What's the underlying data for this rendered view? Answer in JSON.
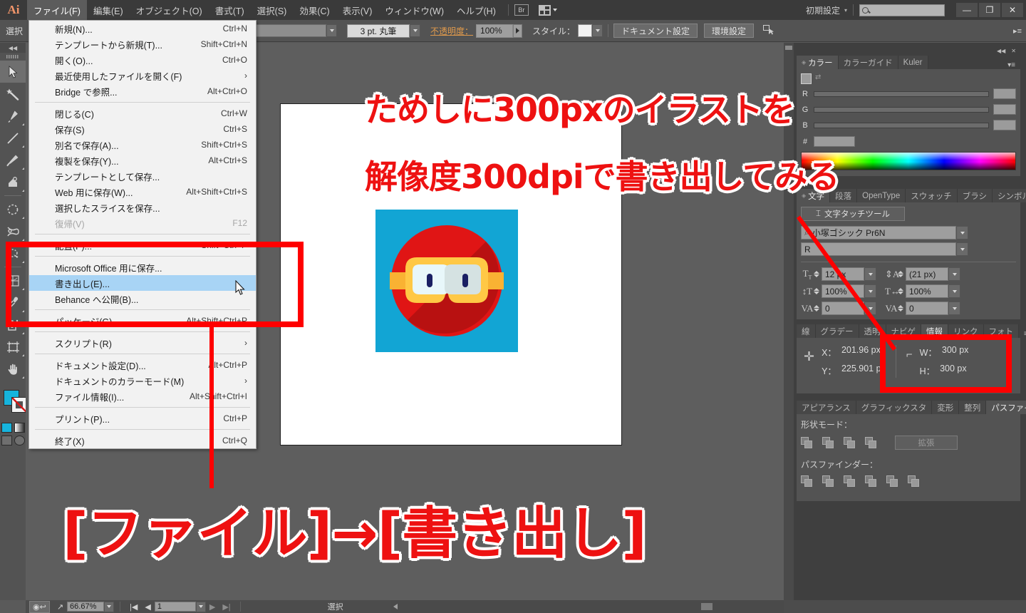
{
  "app": {
    "logo": "Ai",
    "menus": [
      "ファイル(F)",
      "編集(E)",
      "オブジェクト(O)",
      "書式(T)",
      "選択(S)",
      "効果(C)",
      "表示(V)",
      "ウィンドウ(W)",
      "ヘルプ(H)"
    ],
    "bridge_label": "Br",
    "workspace": "初期設定",
    "search_placeholder": "",
    "window_buttons": [
      "—",
      "❐",
      "✕"
    ],
    "accent_red": "#ff0000",
    "highlight_blue": "#a8d4f5"
  },
  "file_menu": {
    "open": true,
    "items": [
      {
        "label": "新規(N)...",
        "shortcut": "Ctrl+N"
      },
      {
        "label": "テンプレートから新規(T)...",
        "shortcut": "Shift+Ctrl+N"
      },
      {
        "label": "開く(O)...",
        "shortcut": "Ctrl+O"
      },
      {
        "label": "最近使用したファイルを開く(F)",
        "shortcut": "",
        "submenu": true
      },
      {
        "label": "Bridge で参照...",
        "shortcut": "Alt+Ctrl+O"
      },
      {
        "separator": true
      },
      {
        "label": "閉じる(C)",
        "shortcut": "Ctrl+W"
      },
      {
        "label": "保存(S)",
        "shortcut": "Ctrl+S"
      },
      {
        "label": "別名で保存(A)...",
        "shortcut": "Shift+Ctrl+S"
      },
      {
        "label": "複製を保存(Y)...",
        "shortcut": "Alt+Ctrl+S"
      },
      {
        "label": "テンプレートとして保存...",
        "shortcut": ""
      },
      {
        "label": "Web 用に保存(W)...",
        "shortcut": "Alt+Shift+Ctrl+S"
      },
      {
        "label": "選択したスライスを保存...",
        "shortcut": ""
      },
      {
        "label": "復帰(V)",
        "shortcut": "F12",
        "disabled": true
      },
      {
        "separator": true
      },
      {
        "label": "配置(P)...",
        "shortcut": "Shift+Ctrl+P"
      },
      {
        "separator": true
      },
      {
        "label": "Microsoft Office 用に保存...",
        "shortcut": ""
      },
      {
        "label": "書き出し(E)...",
        "shortcut": "",
        "highlighted": true
      },
      {
        "label": "Behance へ公開(B)...",
        "shortcut": ""
      },
      {
        "separator": true
      },
      {
        "label": "パッケージ(G)...",
        "shortcut": "Alt+Shift+Ctrl+P"
      },
      {
        "separator": true
      },
      {
        "label": "スクリプト(R)",
        "shortcut": "",
        "submenu": true
      },
      {
        "separator": true
      },
      {
        "label": "ドキュメント設定(D)...",
        "shortcut": "Alt+Ctrl+P"
      },
      {
        "label": "ドキュメントのカラーモード(M)",
        "shortcut": "",
        "submenu": true
      },
      {
        "label": "ファイル情報(I)...",
        "shortcut": "Alt+Shift+Ctrl+I"
      },
      {
        "separator": true
      },
      {
        "label": "プリント(P)...",
        "shortcut": "Ctrl+P"
      },
      {
        "separator": true
      },
      {
        "label": "終了(X)",
        "shortcut": "Ctrl+Q"
      }
    ]
  },
  "control_bar": {
    "tool_label": "選択",
    "stroke_profile": "3 pt. 丸筆",
    "opacity_label": "不透明度：",
    "opacity_value": "100%",
    "style_label": "スタイル：",
    "document_setup": "ドキュメント設定",
    "preferences": "環境設定"
  },
  "toolbar": {
    "tools": [
      "selection-tool",
      "magic-wand-tool",
      "pen-tool",
      "line-segment-tool",
      "paintbrush-tool",
      "shape-builder-tool",
      "rotate-tool",
      "scissors-tool",
      "free-transform-tool",
      "mesh-tool",
      "eyedropper-tool",
      "symbol-sprayer-tool",
      "artboard-tool",
      "hand-tool"
    ],
    "fill_color": "#16b4dd",
    "stroke_color": "none"
  },
  "color_panel": {
    "tabs": [
      "カラー",
      "カラーガイド",
      "Kuler"
    ],
    "active_tab": "カラー",
    "sliders": [
      {
        "label": "R",
        "value": ""
      },
      {
        "label": "G",
        "value": ""
      },
      {
        "label": "B",
        "value": ""
      }
    ],
    "hex_label": "#"
  },
  "character_panel": {
    "tabs": [
      "文字",
      "段落",
      "OpenType",
      "スウォッチ",
      "ブラシ",
      "シンボル"
    ],
    "active_tab": "文字",
    "touch_type_button": "文字タッチツール",
    "font_family": "小塚ゴシック Pr6N",
    "font_style": "R",
    "font_size": "12 px",
    "leading": "(21 px)",
    "vertical_scale": "100%",
    "horizontal_scale": "100%",
    "tracking": "0",
    "kerning": "0"
  },
  "info_panel": {
    "tabs": [
      "線",
      "グラデー",
      "透明",
      "ナビゲ",
      "情報",
      "リンク",
      "フォト"
    ],
    "active_tab": "情報",
    "x_label": "X：",
    "x_value": "201.96 px",
    "y_label": "Y：",
    "y_value": "225.901 px",
    "w_label": "W：",
    "w_value": "300 px",
    "h_label": "H：",
    "h_value": "300 px"
  },
  "pathfinder_panel": {
    "tabs": [
      "アピアランス",
      "グラフィックスタ",
      "変形",
      "整列",
      "パスファインダー"
    ],
    "active_tab": "パスファインダー",
    "shape_mode_label": "形状モード：",
    "expand_button": "拡張",
    "pathfinder_label": "パスファインダー："
  },
  "status_bar": {
    "zoom": "66.67%",
    "page": "1",
    "tool_status": "選択"
  },
  "annotations": {
    "line1": "ためしに300pxのイラストを",
    "line2": "解像度300dpiで書き出してみる",
    "bottom": "[ファイル]→[書き出し]"
  },
  "artwork": {
    "name": "ninja-goggles-icon",
    "background": "#12a5d4",
    "face": "#e01515",
    "face_shadow": "#b81111",
    "goggle_frame": "#f9b233",
    "goggle_frame_light": "#ffc845",
    "lens_left": "#e8f7fa",
    "lens_right": "#d5e2e2",
    "pupil": "#1a1f63"
  }
}
